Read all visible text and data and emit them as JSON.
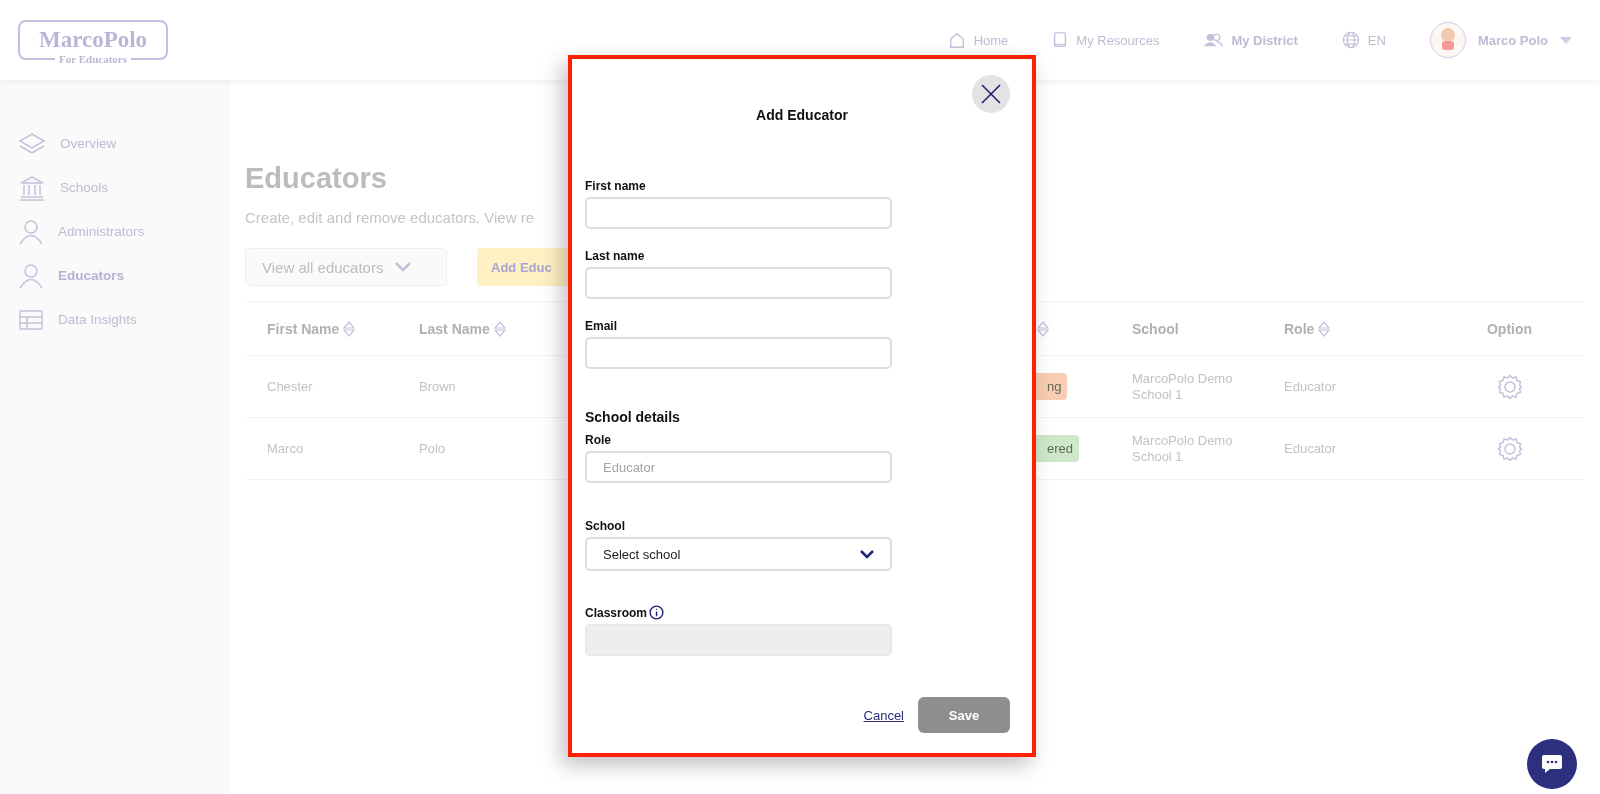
{
  "header": {
    "logo": {
      "name": "MarcoPolo",
      "tagline": "For Educators"
    },
    "nav": [
      {
        "label": "Home",
        "selected": false
      },
      {
        "label": "My Resources",
        "selected": false
      },
      {
        "label": "My District",
        "selected": true
      }
    ],
    "language": "EN",
    "user": {
      "name": "Marco Polo"
    }
  },
  "sidebar": {
    "items": [
      {
        "label": "Overview",
        "selected": false
      },
      {
        "label": "Schools",
        "selected": false
      },
      {
        "label": "Administrators",
        "selected": false
      },
      {
        "label": "Educators",
        "selected": true
      },
      {
        "label": "Data Insights",
        "selected": false
      }
    ]
  },
  "main": {
    "title": "Educators",
    "subtitle": "Create, edit and remove educators. View re",
    "filter": {
      "value": "View all educators"
    },
    "add_button": "Add Educ",
    "table": {
      "columns": [
        {
          "label": "First Name",
          "sortable": true
        },
        {
          "label": "Last Name",
          "sortable": true
        },
        {
          "sortable": true
        },
        {
          "label": "School",
          "sortable": false
        },
        {
          "label": "Role",
          "sortable": true
        },
        {
          "label": "Option",
          "sortable": false
        }
      ],
      "rows": [
        {
          "first_name": "Chester",
          "last_name": "Brown",
          "status": {
            "text": "ng",
            "color": "#f8cdb2"
          },
          "school": "MarcoPolo Demo School 1",
          "role": "Educator"
        },
        {
          "first_name": "Marco",
          "last_name": "Polo",
          "status": {
            "text": "ered",
            "color": "#cfe8c9"
          },
          "school": "MarcoPolo Demo School 1",
          "role": "Educator"
        }
      ]
    }
  },
  "modal": {
    "title": "Add Educator",
    "sections": [
      {
        "fields": [
          {
            "label": "First name",
            "kind": "input",
            "info": false,
            "disabled": false
          },
          {
            "label": "Last name",
            "kind": "input",
            "info": false,
            "disabled": false
          },
          {
            "label": "Email",
            "kind": "input",
            "info": false,
            "disabled": false
          }
        ]
      },
      {
        "heading": "School details",
        "fields": [
          {
            "label": "Role",
            "kind": "input",
            "placeholder": "Educator",
            "info": false,
            "disabled": false
          },
          {
            "label": "School",
            "kind": "select",
            "value": "Select school",
            "info": false,
            "disabled": false
          },
          {
            "label": "Classroom",
            "kind": "input",
            "info": true,
            "disabled": true
          }
        ]
      }
    ],
    "cancel": "Cancel",
    "save": {
      "label": "Save",
      "disabled": true
    }
  }
}
